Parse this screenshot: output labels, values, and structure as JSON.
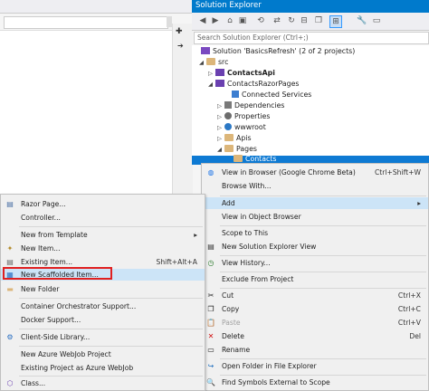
{
  "solution_explorer": {
    "title": "Solution Explorer",
    "search_placeholder": "Search Solution Explorer (Ctrl+;)",
    "tree": [
      {
        "label": "Solution 'BasicsRefresh' (2 of 2 projects)"
      },
      {
        "label": "src"
      },
      {
        "label": "ContactsApi"
      },
      {
        "label": "ContactsRazorPages"
      },
      {
        "label": "Connected Services"
      },
      {
        "label": "Dependencies"
      },
      {
        "label": "Properties"
      },
      {
        "label": "wwwroot"
      },
      {
        "label": "Apis"
      },
      {
        "label": "Pages"
      },
      {
        "label": "Contacts"
      }
    ]
  },
  "context_menu": {
    "items": [
      {
        "label": "View in Browser (Google Chrome Beta)",
        "shortcut": "Ctrl+Shift+W"
      },
      {
        "label": "Browse With..."
      },
      {
        "label": "Add",
        "submenu_arrow": "▸"
      },
      {
        "label": "View in Object Browser"
      },
      {
        "label": "Scope to This"
      },
      {
        "label": "New Solution Explorer View"
      },
      {
        "label": "View History..."
      },
      {
        "label": "Exclude From Project"
      },
      {
        "label": "Cut",
        "shortcut": "Ctrl+X"
      },
      {
        "label": "Copy",
        "shortcut": "Ctrl+C"
      },
      {
        "label": "Paste",
        "shortcut": "Ctrl+V"
      },
      {
        "label": "Delete",
        "shortcut": "Del"
      },
      {
        "label": "Rename"
      },
      {
        "label": "Open Folder in File Explorer"
      },
      {
        "label": "Find Symbols External to Scope"
      }
    ]
  },
  "add_submenu": {
    "items": [
      {
        "label": "Razor Page..."
      },
      {
        "label": "Controller..."
      },
      {
        "label": "New from Template",
        "submenu_arrow": "▸"
      },
      {
        "label": "New Item..."
      },
      {
        "label": "Existing Item...",
        "shortcut": "Shift+Alt+A"
      },
      {
        "label": "New Scaffolded Item..."
      },
      {
        "label": "New Folder"
      },
      {
        "label": "Container Orchestrator Support..."
      },
      {
        "label": "Docker Support..."
      },
      {
        "label": "Client-Side Library..."
      },
      {
        "label": "New Azure WebJob Project"
      },
      {
        "label": "Existing Project as Azure WebJob"
      },
      {
        "label": "Class..."
      }
    ]
  },
  "colors": {
    "accent": "#007acc",
    "highlight": "#cce4f7",
    "selection": "#0e7ad3",
    "callout": "#e02020"
  },
  "icons": [
    "home-icon",
    "sync-icon",
    "history-icon",
    "refresh-icon",
    "collapse-icon",
    "switch-view-icon",
    "wrench-icon",
    "preview-icon",
    "dropdown-icon",
    "pin-icon"
  ]
}
